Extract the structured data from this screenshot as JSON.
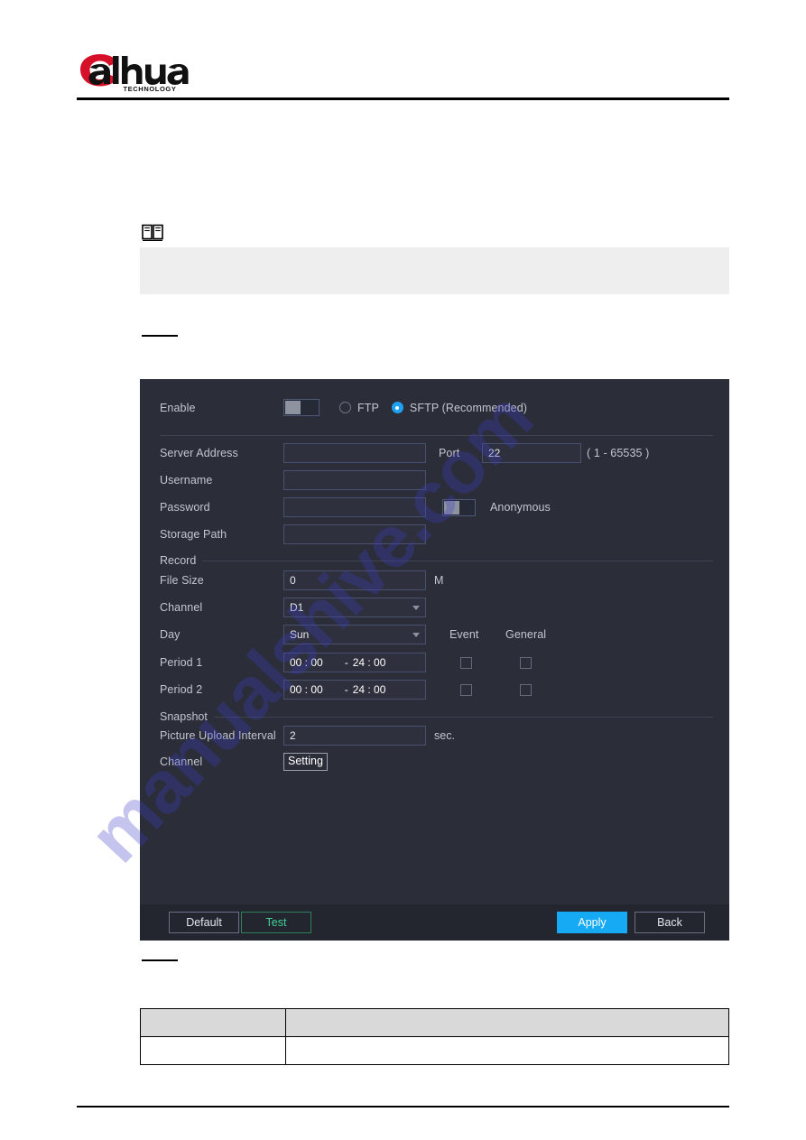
{
  "page": {
    "brand": "Dahua",
    "brand_sub": "TECHNOLOGY",
    "watermark": "manualshive.com"
  },
  "note": {
    "icon": "book-note-icon",
    "text": ""
  },
  "figure_caption": "",
  "table_caption": "",
  "dialog": {
    "enable": {
      "label": "Enable",
      "toggle_state": "off",
      "protocols": [
        {
          "label": "FTP",
          "selected": false
        },
        {
          "label": "SFTP (Recommended)",
          "selected": true
        }
      ]
    },
    "server": {
      "address_label": "Server Address",
      "address_value": "",
      "port_label": "Port",
      "port_value": "22",
      "port_hint": "( 1 - 65535 )",
      "username_label": "Username",
      "username_value": "",
      "password_label": "Password",
      "password_value": "",
      "anonymous_label": "Anonymous",
      "anonymous_state": "off",
      "storage_path_label": "Storage Path",
      "storage_path_value": ""
    },
    "record": {
      "group_label": "Record",
      "file_size_label": "File Size",
      "file_size_value": "0",
      "file_size_unit": "M",
      "channel_label": "Channel",
      "channel_value": "D1",
      "day_label": "Day",
      "day_value": "Sun",
      "col_event": "Event",
      "col_general": "General",
      "periods": [
        {
          "label": "Period 1",
          "start": "00 : 00",
          "dash": "-",
          "end": "24 : 00",
          "event_checked": false,
          "general_checked": false
        },
        {
          "label": "Period 2",
          "start": "00 : 00",
          "dash": "-",
          "end": "24 : 00",
          "event_checked": false,
          "general_checked": false
        }
      ]
    },
    "snapshot": {
      "group_label": "Snapshot",
      "interval_label": "Picture Upload Interval",
      "interval_value": "2",
      "interval_unit": "sec.",
      "channel_label": "Channel",
      "setting_button": "Setting"
    },
    "footer": {
      "default": "Default",
      "test": "Test",
      "apply": "Apply",
      "back": "Back"
    },
    "colors": {
      "accent_blue": "#16aaf5",
      "test_green": "#3fcf93",
      "dialog_bg": "#2b2e39",
      "footer_bg": "#24262f"
    }
  },
  "bottom_table": {
    "header": [
      "",
      ""
    ],
    "rows": [
      [
        "",
        ""
      ]
    ]
  }
}
